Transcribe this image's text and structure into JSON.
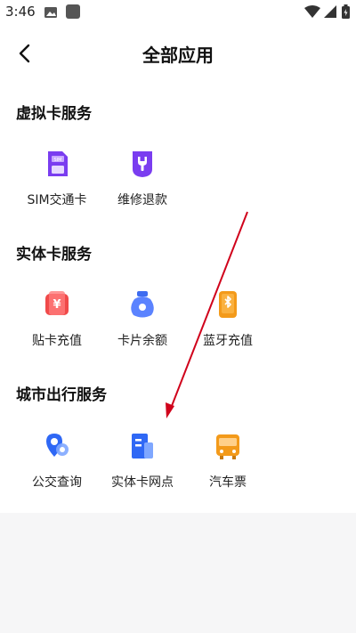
{
  "statusbar": {
    "time": "3:46"
  },
  "header": {
    "title": "全部应用"
  },
  "sections": [
    {
      "title": "虚拟卡服务",
      "apps": [
        {
          "label": "SIM交通卡"
        },
        {
          "label": "维修退款"
        }
      ]
    },
    {
      "title": "实体卡服务",
      "apps": [
        {
          "label": "贴卡充值"
        },
        {
          "label": "卡片余额"
        },
        {
          "label": "蓝牙充值"
        }
      ]
    },
    {
      "title": "城市出行服务",
      "apps": [
        {
          "label": "公交查询"
        },
        {
          "label": "实体卡网点"
        },
        {
          "label": "汽车票"
        }
      ]
    }
  ],
  "colors": {
    "accent_purple": "#7a3df0",
    "accent_red": "#f04a4a",
    "accent_blue": "#3d6cf0",
    "accent_orange": "#f39a1a",
    "annotation_arrow": "#d0021b"
  }
}
